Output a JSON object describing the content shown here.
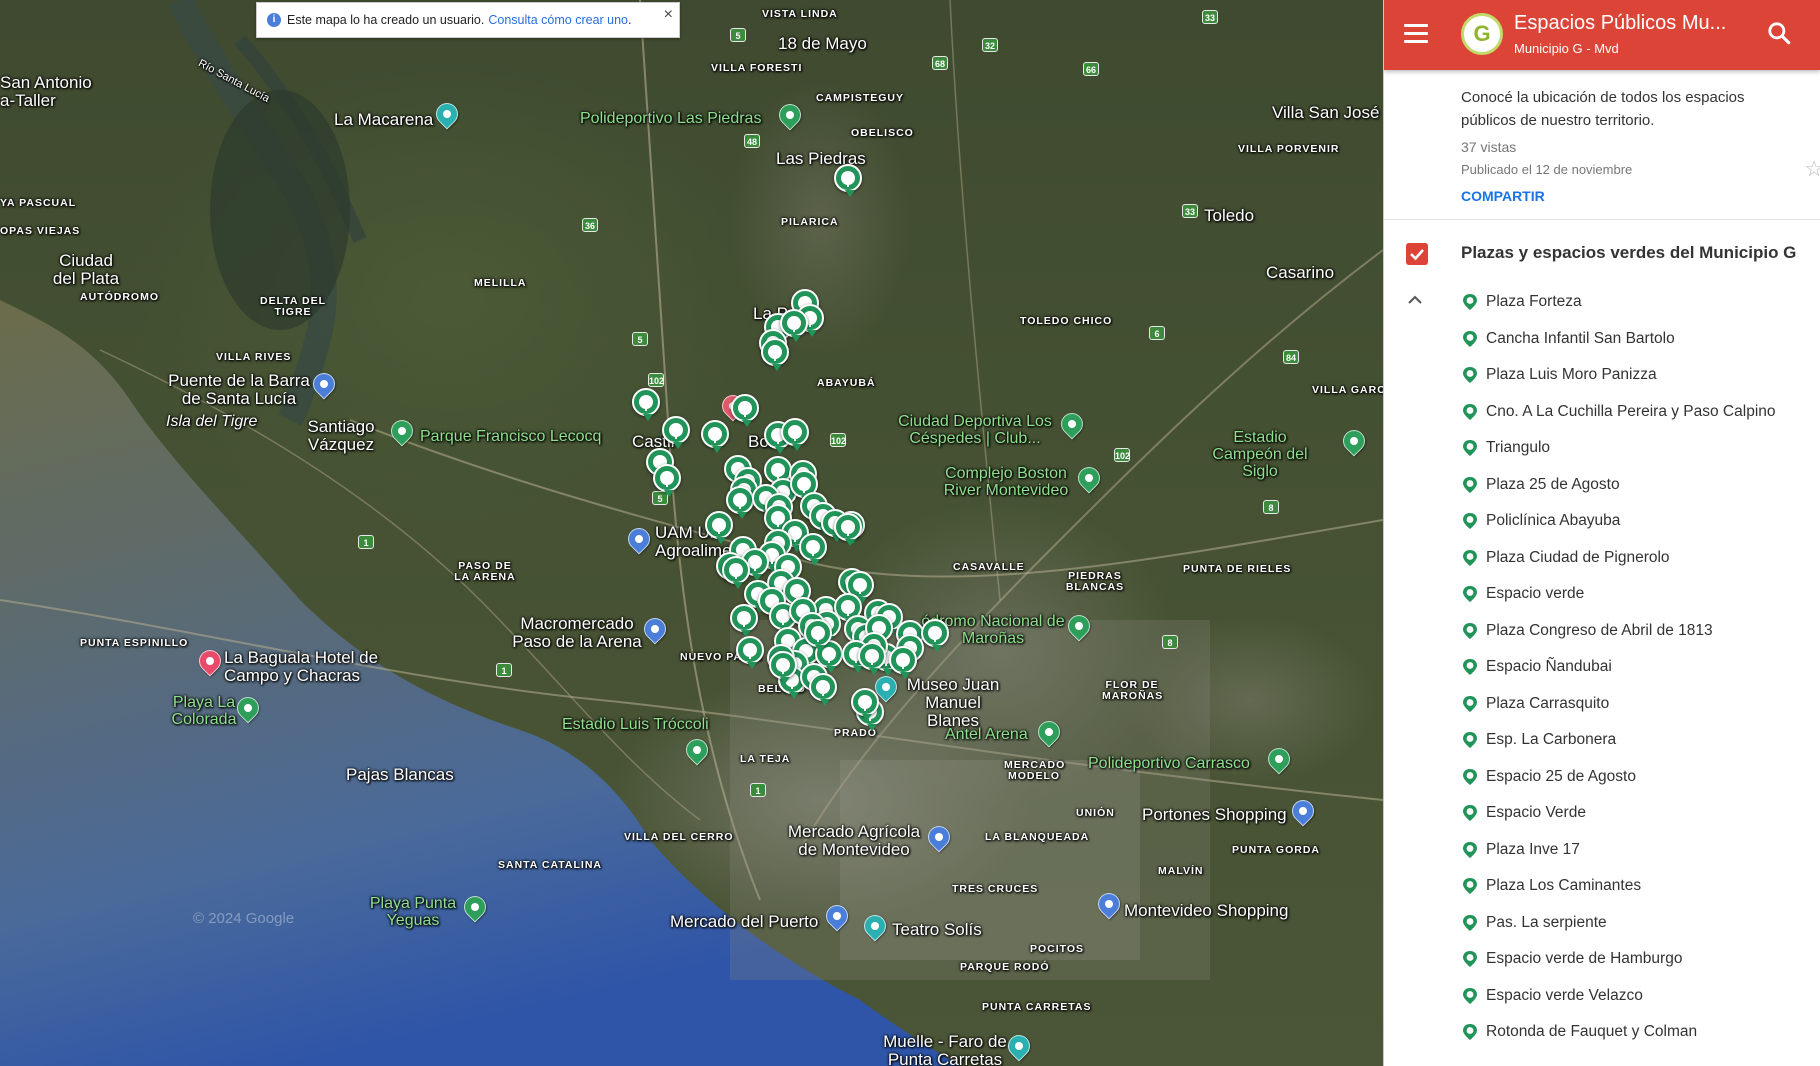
{
  "map": {
    "info_bar": {
      "text": "Este mapa lo ha creado un usuario.",
      "link": "Consulta cómo crear uno",
      "link_suffix": ".",
      "close": "×"
    },
    "labels": {
      "san_antonio": "San Antonio",
      "taller": "a-Taller",
      "la_macarena": "La Macarena",
      "polideportivo_las_piedras": "Polideportivo Las Piedras",
      "las_piedras": "Las Piedras",
      "vista_linda": "VISTA LINDA",
      "dieciocho_mayo": "18 de Mayo",
      "villa_foresti": "VILLA FORESTI",
      "campisteguy": "CAMPISTEGUY",
      "obelisco": "OBELISCO",
      "pilarica": "PILARICA",
      "rio_santa_lucia": "Río Santa Lucía",
      "ya_pascual": "YA PASCUAL",
      "opas_viejas": "OPAS VIEJAS",
      "ciudad_del_plata": "Ciudad del Plata",
      "autodromo": "AUTÓDROMO",
      "delta_del_tigre": "DELTA DEL TIGRE",
      "melilla": "MELILLA",
      "villa_rives": "VILLA RIVES",
      "puente_barra": "Puente de la Barra de Santa Lucía",
      "isla_del_tigre": "Isla del Tigre",
      "santiago_vazquez": "Santiago Vázquez",
      "parque_lecocq": "Parque Francisco Lecocq",
      "la_paz": "La Paz",
      "abayuba": "ABAYUBÁ",
      "toledo_chico": "TOLEDO CHICO",
      "villa_san_jose": "Villa San José",
      "villa_porvenir": "VILLA PORVENIR",
      "toledo": "Toledo",
      "casarino": "Casarino",
      "villa_garc": "VILLA GARC",
      "ciudad_deportiva": "Ciudad Deportiva Los Céspedes | Club...",
      "estadio_campeon": "Estadio Campeón del Siglo",
      "complejo_boston": "Complejo Boston River Montevideo",
      "castillo": "Castil",
      "bor": "Bor",
      "uam": "UAM Un Agroalimen",
      "casavalle": "CASAVALLE",
      "piedras_blancas": "PIEDRAS BLANCAS",
      "punta_de_rieles": "PUNTA DE RIELES",
      "paso_de_la_arena": "PASO DE LA ARENA",
      "punta_espinillo": "PUNTA ESPINILLO",
      "la_baguala": "La Baguala Hotel de Campo y Chacras",
      "macromercado": "Macromercado Paso de la Arena",
      "nuevo_paris": "NUEVO PARÍS",
      "hipodromo": "ódromo Nacional de Maroñas",
      "belved": "BELVED",
      "museo_blanes": "Museo Juan Manuel Blanes",
      "flor_maronas": "FLOR DE MAROÑAS",
      "playa_la_colorada": "Playa La Colorada",
      "estadio_troccoli": "Estadio Luis Tróccoli",
      "prado": "PRADO",
      "antel_arena": "Antel Arena",
      "polideportivo_carrasco": "Polideportivo Carrasco",
      "pajas_blancas": "Pajas Blancas",
      "la_teja": "LA TEJA",
      "mercado_modelo": "MERCADO MODELO",
      "union": "UNIÓN",
      "portones": "Portones Shopping",
      "villa_del_cerro": "VILLA DEL CERRO",
      "mercado_agricola": "Mercado Agrícola de Montevideo",
      "la_blanqueada": "LA BLANQUEADA",
      "punta_gorda": "PUNTA GORDA",
      "malvin": "MALVÍN",
      "santa_catalina": "SANTA CATALINA",
      "playa_punta_yeguas": "Playa Punta Yeguas",
      "tres_cruces": "TRES CRUCES",
      "montevideo_shopping": "Montevideo Shopping",
      "mercado_puerto": "Mercado del Puerto",
      "teatro_solis": "Teatro Solís",
      "pocitos": "POCITOS",
      "parque_rodo": "PARQUE RODÓ",
      "punta_carretas": "PUNTA CARRETAS",
      "muelle_faro": "Muelle - Faro de Punta Carretas",
      "copyright": "© 2024 Google",
      "google": "Google"
    },
    "road_shields": [
      "5",
      "33",
      "32",
      "66",
      "68",
      "48",
      "36",
      "33",
      "5",
      "102",
      "6",
      "84",
      "102",
      "8",
      "5",
      "1",
      "102",
      "1",
      "8",
      "1"
    ]
  },
  "sidebar": {
    "title": "Espacios Públicos Mu...",
    "subtitle": "Municipio G - Mvd",
    "logo_letter": "G",
    "description": "Conocé la ubicación de todos los espacios públicos de nuestro territorio.",
    "views": "37 vistas",
    "published": "Publicado el 12 de noviembre",
    "share": "COMPARTIR",
    "layer_title": "Plazas y espacios verdes del Municipio G",
    "places": [
      "Plaza Forteza",
      "Cancha Infantil San Bartolo",
      "Plaza Luis Moro Panizza",
      "Cno. A La Cuchilla Pereira y Paso Calpino",
      "Triangulo",
      "Plaza 25 de Agosto",
      "Policlínica Abayuba",
      "Plaza Ciudad de Pignerolo",
      "Espacio verde",
      "Plaza Congreso de Abril de 1813",
      "Espacio Ñandubai",
      "Plaza Carrasquito",
      "Esp. La Carbonera",
      "Espacio 25 de Agosto",
      "Espacio Verde",
      "Plaza Inve 17",
      "Plaza Los Caminantes",
      "Pas. La serpiente",
      "Espacio verde de Hamburgo",
      "Espacio verde Velazco",
      "Rotonda de Fauquet y Colman"
    ]
  },
  "colors": {
    "header_red": "#db4437",
    "marker_green": "#21945a",
    "poi_green": "#2e9e5b",
    "link_blue": "#1a73e8"
  }
}
